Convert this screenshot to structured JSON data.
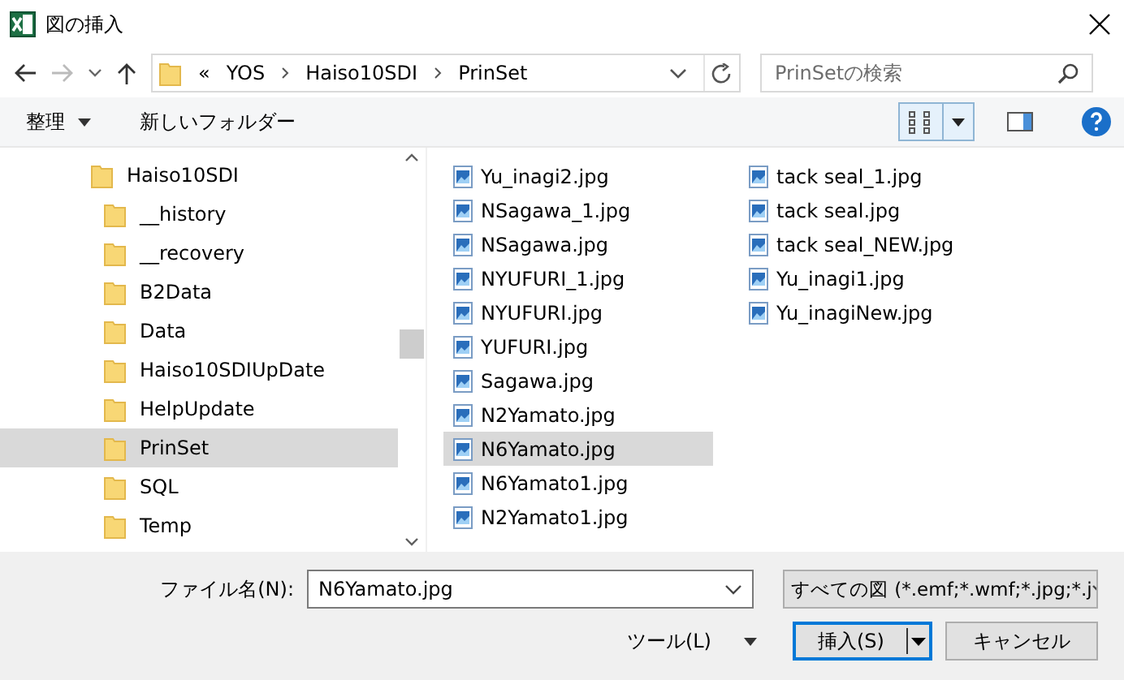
{
  "window": {
    "title": "図の挿入"
  },
  "address_bar": {
    "segments": [
      "«",
      "YOS",
      "Haiso10SDI",
      "PrinSet"
    ]
  },
  "search": {
    "placeholder": "PrinSetの検索"
  },
  "toolbar": {
    "organize": "整理",
    "new_folder": "新しいフォルダー"
  },
  "tree": {
    "items": [
      {
        "label": "Haiso10SDI",
        "selected": false,
        "children": [
          {
            "label": "__history",
            "selected": false
          },
          {
            "label": "__recovery",
            "selected": false
          },
          {
            "label": "B2Data",
            "selected": false
          },
          {
            "label": "Data",
            "selected": false
          },
          {
            "label": "Haiso10SDIUpDate",
            "selected": false
          },
          {
            "label": "HelpUpdate",
            "selected": false
          },
          {
            "label": "PrinSet",
            "selected": true
          },
          {
            "label": "SQL",
            "selected": false
          },
          {
            "label": "Temp",
            "selected": false
          }
        ]
      }
    ]
  },
  "files": [
    {
      "name": "Yu_inagi2.jpg",
      "selected": false
    },
    {
      "name": "NSagawa_1.jpg",
      "selected": false
    },
    {
      "name": "NSagawa.jpg",
      "selected": false
    },
    {
      "name": "NYUFURI_1.jpg",
      "selected": false
    },
    {
      "name": "NYUFURI.jpg",
      "selected": false
    },
    {
      "name": "YUFURI.jpg",
      "selected": false
    },
    {
      "name": "Sagawa.jpg",
      "selected": false
    },
    {
      "name": "N2Yamato.jpg",
      "selected": false
    },
    {
      "name": "N6Yamato.jpg",
      "selected": true
    },
    {
      "name": "N6Yamato1.jpg",
      "selected": false
    },
    {
      "name": "N2Yamato1.jpg",
      "selected": false
    },
    {
      "name": "tack seal_1.jpg",
      "selected": false
    },
    {
      "name": "tack seal.jpg",
      "selected": false
    },
    {
      "name": "tack seal_NEW.jpg",
      "selected": false
    },
    {
      "name": "Yu_inagi1.jpg",
      "selected": false
    },
    {
      "name": "Yu_inagiNew.jpg",
      "selected": false
    }
  ],
  "footer": {
    "file_name_label": "ファイル名(N):",
    "file_name": "N6Yamato.jpg",
    "file_type": "すべての図 (*.emf;*.wmf;*.jpg;*.j",
    "tools": "ツール(L)",
    "insert": "挿入(S)",
    "cancel": "キャンセル"
  }
}
